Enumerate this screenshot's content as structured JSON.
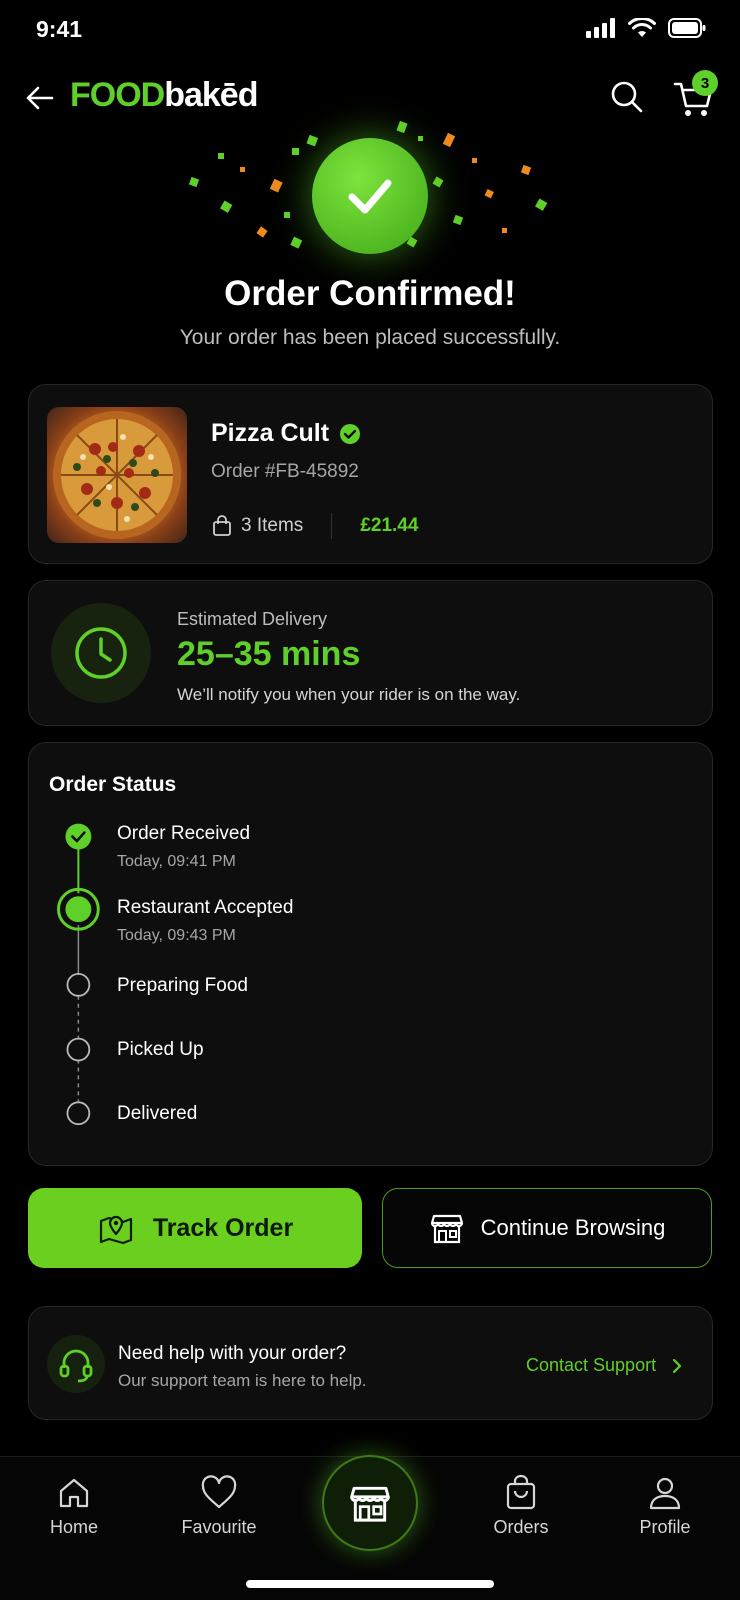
{
  "status_bar": {
    "time": "9:41"
  },
  "header": {
    "logo_food": "FOOD",
    "logo_baked": "bakēd",
    "cart_count": "3",
    "icons": [
      "back-arrow-icon",
      "search-icon",
      "cart-icon"
    ]
  },
  "confirmation": {
    "title": "Order Confirmed!",
    "subtitle": "Your order has been placed successfully.",
    "icon": "check-icon"
  },
  "order": {
    "restaurant": "Pizza Cult",
    "order_number": "Order #FB-45892",
    "items": "3 Items",
    "total": "£21.44"
  },
  "delivery": {
    "label": "Estimated Delivery",
    "time": "25–35 mins",
    "note": "We’ll notify you when your rider is on the way."
  },
  "order_status": {
    "title": "Order Status",
    "steps": [
      {
        "label": "Order Received",
        "time": "Today, 09:41 PM",
        "state": "done"
      },
      {
        "label": "Restaurant Accepted",
        "time": "Today, 09:43 PM",
        "state": "current"
      },
      {
        "label": "Preparing Food",
        "state": "pending"
      },
      {
        "label": "Picked Up",
        "state": "pending"
      },
      {
        "label": "Delivered",
        "state": "pending"
      }
    ]
  },
  "actions": {
    "track": "Track Order",
    "browse": "Continue Browsing"
  },
  "help": {
    "title": "Need help with your order?",
    "subtitle": "Our support team is here to help.",
    "link": "Contact Support"
  },
  "nav": {
    "home": "Home",
    "favourite": "Favourite",
    "orders": "Orders",
    "profile": "Profile"
  },
  "colors": {
    "accent": "#5fcf2a",
    "background": "#000000",
    "card": "#0e0e0e"
  }
}
